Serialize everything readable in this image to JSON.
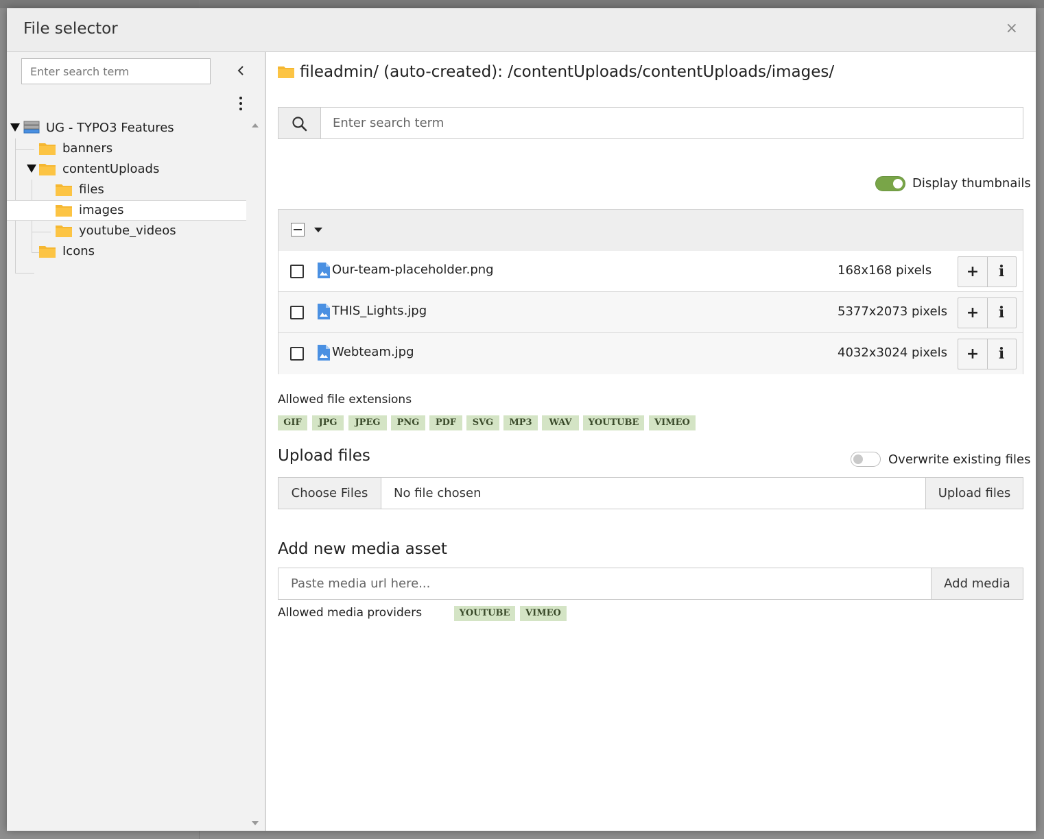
{
  "modal": {
    "title": "File selector",
    "close_icon": "×"
  },
  "tree": {
    "search_placeholder": "Enter search term",
    "items": [
      {
        "label": "UG - TYPO3 Features",
        "icon": "server-icon",
        "expanded": true
      },
      {
        "label": "banners",
        "icon": "folder-icon"
      },
      {
        "label": "contentUploads",
        "icon": "folder-icon",
        "expanded": true
      },
      {
        "label": "files",
        "icon": "folder-icon"
      },
      {
        "label": "images",
        "icon": "folder-icon",
        "selected": true
      },
      {
        "label": "youtube_videos",
        "icon": "folder-icon"
      },
      {
        "label": "Icons",
        "icon": "folder-icon"
      }
    ]
  },
  "main": {
    "path": "fileadmin/ (auto-created): /contentUploads/contentUploads/images/",
    "search_placeholder": "Enter search term",
    "display_thumbnails_label": "Display thumbnails",
    "display_thumbnails_on": true,
    "files": [
      {
        "name": "Our-team-placeholder.png",
        "dimensions": "168x168 pixels"
      },
      {
        "name": "THIS_Lights.jpg",
        "dimensions": "5377x2073 pixels"
      },
      {
        "name": "Webteam.jpg",
        "dimensions": "4032x3024 pixels"
      }
    ],
    "row_add_icon": "+",
    "row_info_icon": "i",
    "allowed_ext_title": "Allowed file extensions",
    "extensions": [
      "GIF",
      "JPG",
      "JPEG",
      "PNG",
      "PDF",
      "SVG",
      "MP3",
      "WAV",
      "YOUTUBE",
      "VIMEO"
    ]
  },
  "upload": {
    "title": "Upload files",
    "overwrite_label": "Overwrite existing files",
    "overwrite_on": false,
    "choose_label": "Choose Files",
    "no_file_text": "No file chosen",
    "upload_button": "Upload files"
  },
  "media": {
    "title": "Add new media asset",
    "url_placeholder": "Paste media url here...",
    "add_button": "Add media",
    "providers_label": "Allowed media providers",
    "providers": [
      "YOUTUBE",
      "VIMEO"
    ]
  },
  "colors": {
    "folder": "#f5b731",
    "toggle_on": "#79a548",
    "badge_bg": "#d4e4c5",
    "file_icon": "#4a90e2"
  }
}
